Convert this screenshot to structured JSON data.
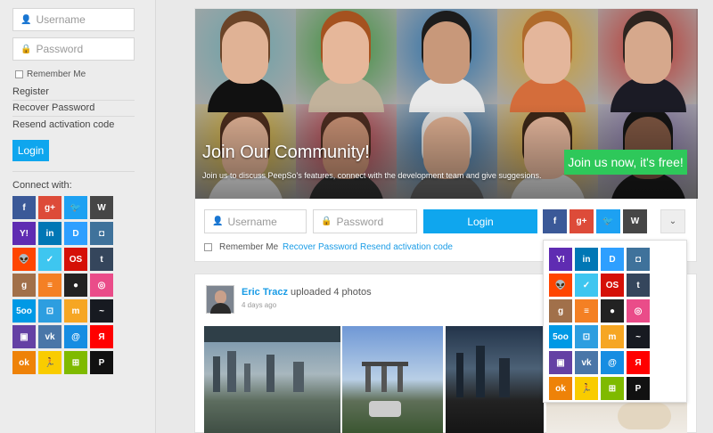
{
  "sidebar": {
    "username_placeholder": "Username",
    "password_placeholder": "Password",
    "remember_label": "Remember Me",
    "links": [
      "Register",
      "Recover Password",
      "Resend activation code"
    ],
    "login_label": "Login",
    "connect_label": "Connect with:"
  },
  "hero": {
    "title": "Join Our Community!",
    "subtitle": "Join us to discuss PeepSo's features, connect with the development team and give suggesions.",
    "cta_label": "Join us now, it's free!"
  },
  "login_bar": {
    "username_placeholder": "Username",
    "password_placeholder": "Password",
    "login_label": "Login",
    "remember_label": "Remember Me",
    "recover_label": "Recover Password",
    "resend_label": "Resend activation code",
    "more_icon": "chevron-down-icon"
  },
  "post": {
    "author": "Eric Tracz",
    "action": "uploaded 4 photos",
    "time": "4 days ago"
  },
  "social": [
    {
      "name": "facebook",
      "glyph": "f",
      "color": "#3b5998"
    },
    {
      "name": "googleplus",
      "glyph": "g+",
      "color": "#dd4b39"
    },
    {
      "name": "twitter",
      "glyph": "🐦",
      "color": "#1da1f2"
    },
    {
      "name": "wordpress",
      "glyph": "W",
      "color": "#464646"
    },
    {
      "name": "yahoo",
      "glyph": "Y!",
      "color": "#5f2cb2"
    },
    {
      "name": "linkedin",
      "glyph": "in",
      "color": "#0077b5"
    },
    {
      "name": "disqus",
      "glyph": "D",
      "color": "#2e9fff"
    },
    {
      "name": "instagram",
      "glyph": "◘",
      "color": "#3f729b"
    },
    {
      "name": "reddit",
      "glyph": "👽",
      "color": "#ff4500"
    },
    {
      "name": "delicious",
      "glyph": "✓",
      "color": "#3ec6f0"
    },
    {
      "name": "lastfm",
      "glyph": "OS",
      "color": "#d51007"
    },
    {
      "name": "tumblr",
      "glyph": "t",
      "color": "#35465c"
    },
    {
      "name": "goodreads",
      "glyph": "g",
      "color": "#a1704a"
    },
    {
      "name": "stackoverflow",
      "glyph": "≡",
      "color": "#f48024"
    },
    {
      "name": "github",
      "glyph": "●",
      "color": "#222222"
    },
    {
      "name": "dribbble",
      "glyph": "◎",
      "color": "#ea4c89"
    },
    {
      "name": "500px",
      "glyph": "5oo",
      "color": "#0099e5"
    },
    {
      "name": "foursquare",
      "glyph": "⊡",
      "color": "#2d9ee0"
    },
    {
      "name": "meetup",
      "glyph": "m",
      "color": "#f6a623"
    },
    {
      "name": "steam",
      "glyph": "~",
      "color": "#171a21"
    },
    {
      "name": "twitch",
      "glyph": "▣",
      "color": "#6441a4"
    },
    {
      "name": "vk",
      "glyph": "vk",
      "color": "#4a76a8"
    },
    {
      "name": "mailru",
      "glyph": "@",
      "color": "#168de2"
    },
    {
      "name": "yandex",
      "glyph": "Я",
      "color": "#ff0000"
    },
    {
      "name": "odnoklassniki",
      "glyph": "ok",
      "color": "#ee8208"
    },
    {
      "name": "runkeeper",
      "glyph": "🏃",
      "color": "#f9cc00"
    },
    {
      "name": "windows",
      "glyph": "⊞",
      "color": "#7fba00"
    },
    {
      "name": "paypal",
      "glyph": "P",
      "color": "#111111"
    }
  ],
  "hero_tiles": [
    "#6aa1a8",
    "#3e8f3d",
    "#2a6fa8",
    "#cd9d2f",
    "#b8362f",
    "#c9a427",
    "#b0353f",
    "#2c6aa0",
    "#d4a12a",
    "#7a6a9c"
  ],
  "photos": [
    "#6f8fa8",
    "#7fa6c8",
    "#2d4156",
    "#c9ab88"
  ]
}
